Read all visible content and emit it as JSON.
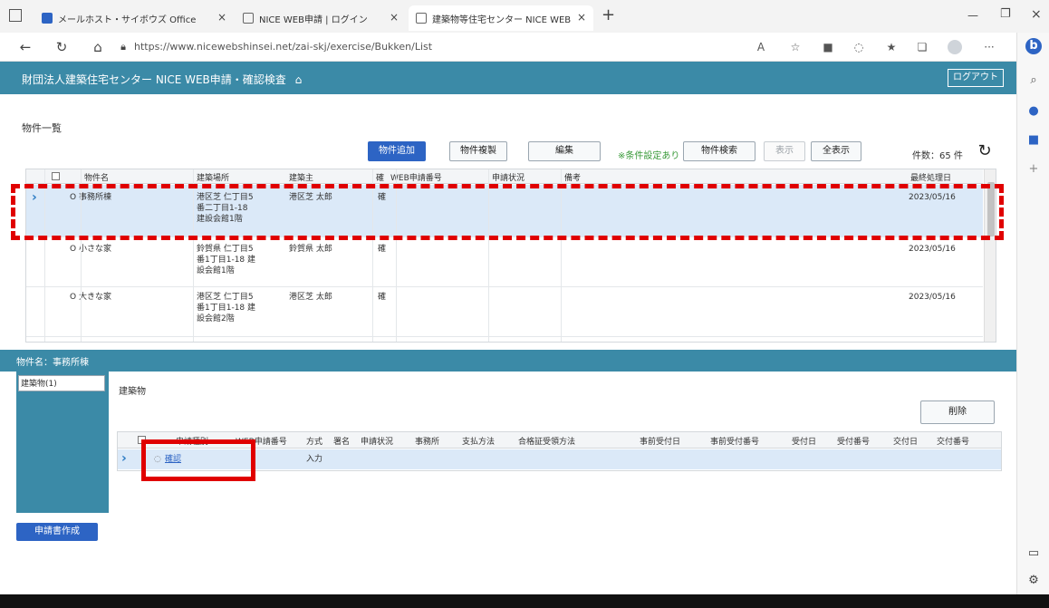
{
  "browser": {
    "tabs": [
      {
        "label": "メールホスト・サイボウズ Office"
      },
      {
        "label": "NICE WEB申請 | ログイン"
      },
      {
        "label": "建築物等住宅センター NICE WEB"
      }
    ],
    "url": "https://www.nicewebshinsei.net/zai-skj/exercise/Bukken/List",
    "new_tab": "+"
  },
  "header": {
    "title": "財団法人建築住宅センター NICE WEB申請・確認検査",
    "logout": "ログアウト"
  },
  "page": {
    "title": "物件一覧"
  },
  "toolbar": {
    "add": "物件追加",
    "copy": "物件複製",
    "edit": "編集",
    "filter_note": "※条件設定あり",
    "search": "物件検索",
    "show": "表示",
    "show_all": "全表示",
    "count": "件数：65 件"
  },
  "grid": {
    "columns": [
      "物件名",
      "建築場所",
      "建築主",
      "確",
      "WEB申請番号",
      "申請状況",
      "備考",
      "最終処理日"
    ],
    "rows": [
      {
        "name": "O 事務所棟",
        "location": "港区芝 仁丁目5番二丁目1-18 建設会館1階",
        "owner": "港区芝 太郎",
        "type": "確",
        "web_no": "",
        "status": "",
        "note": "",
        "date": "2023/05/16"
      },
      {
        "name": "O 小さな家",
        "location": "鈴賀県 仁丁目5番1丁目1-18 建設会館1階",
        "owner": "鈴賀県 太郎",
        "type": "確",
        "web_no": "",
        "status": "",
        "note": "",
        "date": "2023/05/16"
      },
      {
        "name": "O 大きな家",
        "location": "港区芝 仁丁目5番1丁目1-18 建設会館2階",
        "owner": "港区芝 太郎",
        "type": "確",
        "web_no": "",
        "status": "",
        "note": "",
        "date": "2023/05/16"
      }
    ]
  },
  "lower": {
    "bar_title": "物件名：事務所棟",
    "left_item": "建築物(1)",
    "section_label": "建築物",
    "delete": "削除",
    "create": "申請書作成",
    "columns": [
      "申請種別",
      "WEB申請番号",
      "方式",
      "署名",
      "申請状況",
      "事務所",
      "支払方法",
      "合格証受領方法",
      "事前受付日",
      "事前受付番号",
      "受付日",
      "受付番号",
      "交付日",
      "交付番号"
    ],
    "row": {
      "kind": "確認",
      "web_no": "",
      "method": "入力"
    }
  },
  "colors": {
    "accent": "#3b8aa7",
    "primary_button": "#2d64c4",
    "highlight": "#e00000",
    "selected_row": "#dbe9f8"
  }
}
